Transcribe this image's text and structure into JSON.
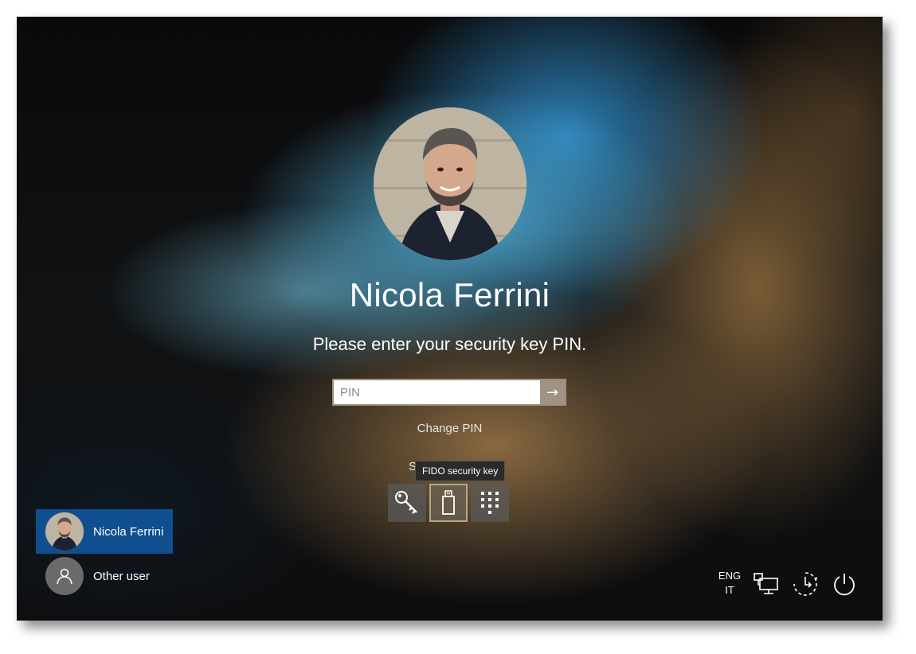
{
  "user": {
    "name": "Nicola Ferrini",
    "prompt": "Please enter your security key PIN."
  },
  "pin_field": {
    "placeholder": "PIN"
  },
  "links": {
    "change_pin": "Change PIN",
    "sign_in_options_partial": "S"
  },
  "tooltip": {
    "text": "FIDO security key"
  },
  "sign_in_options": [
    {
      "id": "key",
      "icon": "key-icon"
    },
    {
      "id": "fido",
      "icon": "usb-key-icon",
      "selected": true
    },
    {
      "id": "pin",
      "icon": "keypad-icon"
    }
  ],
  "user_list": [
    {
      "name": "Nicola Ferrini",
      "selected": true,
      "icon": "user-photo"
    },
    {
      "name": "Other user",
      "selected": false,
      "icon": "person-icon"
    }
  ],
  "system_tray": {
    "lang_primary": "ENG",
    "lang_secondary": "IT",
    "icons": [
      "network-icon",
      "accessibility-icon",
      "power-icon"
    ]
  },
  "colors": {
    "selected_user_bg": "#0f4f8f",
    "selected_option_border": "#b7a787"
  }
}
